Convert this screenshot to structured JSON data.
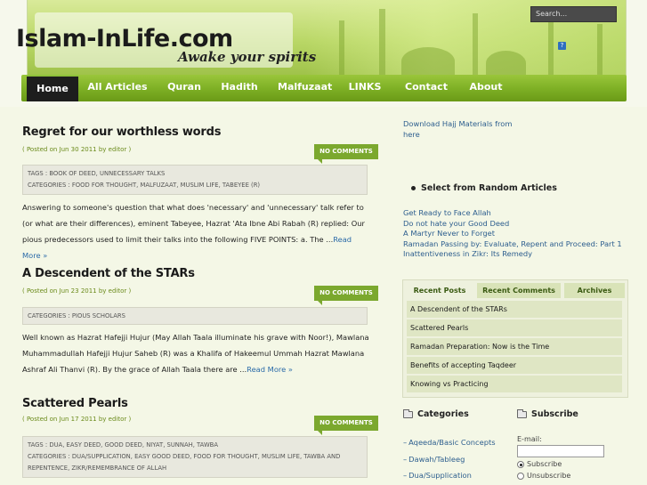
{
  "site": {
    "logo": "Islam-InLife.com",
    "tagline": "Awake your spirits",
    "search_placeholder": "Search..."
  },
  "nav": {
    "items": [
      "Home",
      "All Articles",
      "Quran",
      "Hadith",
      "Malfuzaat",
      "LINKS",
      "Contact",
      "About"
    ],
    "active": "Home"
  },
  "posts": [
    {
      "title": "Regret for our worthless words",
      "meta": "( Posted on Jun 30 2011 by editor )",
      "comments": "NO COMMENTS",
      "tags": "TAGS : BOOK OF DEED, UNNECESSARY TALKS",
      "categories": "CATEGORIES : FOOD FOR THOUGHT, MALFUZAAT, MUSLIM LIFE, TABEYEE (R)",
      "excerpt": "Answering to someone's question that what does 'necessary' and 'unnecessary' talk refer to (or what are their differences), eminent Tabeyee, Hazrat 'Ata Ibne Abi Rabah (R) replied: Our pious predecessors used to limit their talks into the following FIVE POINTS: a. The ...",
      "read_more": "Read More »"
    },
    {
      "title": "A Descendent of the STARs",
      "meta": "( Posted on Jun 23 2011 by editor )",
      "comments": "NO COMMENTS",
      "tags": "",
      "categories": "CATEGORIES : PIOUS SCHOLARS",
      "excerpt": "Well known as Hazrat Hafejji Hujur (May Allah Taala illuminate his grave with Noor!), Mawlana Muhammadullah Hafejji Hujur Saheb (R) was a Khalifa of Hakeemul Ummah Hazrat Mawlana Ashraf Ali Thanvi (R). By the grace of Allah Taala there are ...",
      "read_more": "Read More »"
    },
    {
      "title": "Scattered Pearls",
      "meta": "( Posted on Jun 17 2011 by editor )",
      "comments": "NO COMMENTS",
      "tags": "TAGS : DUA, EASY DEED, GOOD DEED, NIYAT, SUNNAH, TAWBA",
      "categories": "CATEGORIES : DUA/SUPPLICATION, EASY GOOD DEED, FOOD FOR THOUGHT, MUSLIM LIFE, TAWBA AND REPENTENCE, ZIKR/REMEMBRANCE OF ALLAH"
    }
  ],
  "sidebar": {
    "download_link": "Download Hajj Materials from here",
    "random_heading": "Select from Random Articles",
    "random_articles": [
      "Get Ready to Face Allah",
      "Do not hate your Good Deed",
      "A Martyr Never to Forget",
      "Ramadan Passing by: Evaluate, Repent and Proceed: Part 1",
      "Inattentiveness in Zikr: Its Remedy"
    ],
    "tabs": [
      "Recent Posts",
      "Recent Comments",
      "Archives"
    ],
    "recent_posts": [
      "A Descendent of the STARs",
      "Scattered Pearls",
      "Ramadan Preparation: Now is the Time",
      "Benefits of accepting Taqdeer",
      "Knowing vs Practicing"
    ],
    "categories_heading": "Categories",
    "categories": [
      "Aqeeda/Basic Concepts",
      "Dawah/Tableeg",
      "Dua/Supplication"
    ],
    "subscribe_heading": "Subscribe",
    "email_label": "E-mail:",
    "subscribe_option": "Subscribe",
    "unsubscribe_option": "Unsubscribe"
  },
  "colors": {
    "nav_green": "#7fb126",
    "accent_green": "#7ba82e",
    "link_blue": "#2d5e8e"
  }
}
